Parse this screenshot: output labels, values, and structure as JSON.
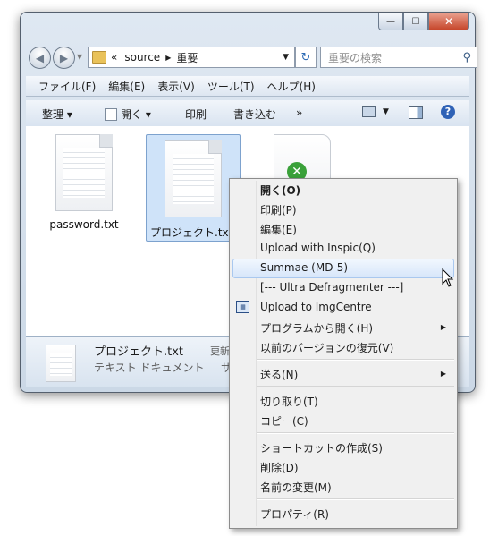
{
  "window": {
    "caption": {
      "minimize": "—",
      "maximize": "☐",
      "close": "✕"
    },
    "address": {
      "prefix": "«",
      "path": [
        "source",
        "重要"
      ]
    },
    "search": {
      "placeholder": "重要の検索"
    },
    "menubar": [
      "ファイル(F)",
      "編集(E)",
      "表示(V)",
      "ツール(T)",
      "ヘルプ(H)"
    ],
    "toolbar": {
      "organize": "整理 ▾",
      "open": "開く ▾",
      "print": "印刷",
      "burn": "書き込む",
      "more": "»"
    },
    "files": [
      {
        "name": "password.txt"
      },
      {
        "name": "プロジェクト.txt"
      }
    ],
    "status": {
      "filename": "プロジェクト.txt",
      "label": "更新",
      "type": "テキスト ドキュメント",
      "extra": "サ"
    }
  },
  "context_menu": {
    "items": [
      {
        "label": "開く(O)",
        "bold": true
      },
      {
        "label": "印刷(P)"
      },
      {
        "label": "編集(E)"
      },
      {
        "label": "Upload with Inspic(Q)"
      },
      {
        "label": "Summae (MD-5)",
        "highlighted": true
      },
      {
        "label": "[--- Ultra Defragmenter ---]"
      },
      {
        "label": "Upload to ImgCentre",
        "icon": "imgcentre-icon"
      },
      {
        "label": "プログラムから開く(H)",
        "submenu": true
      },
      {
        "label": "以前のバージョンの復元(V)"
      },
      {
        "label": "送る(N)",
        "submenu": true
      },
      {
        "label": "切り取り(T)"
      },
      {
        "label": "コピー(C)"
      },
      {
        "label": "ショートカットの作成(S)"
      },
      {
        "label": "削除(D)"
      },
      {
        "label": "名前の変更(M)"
      },
      {
        "label": "プロパティ(R)"
      }
    ]
  }
}
